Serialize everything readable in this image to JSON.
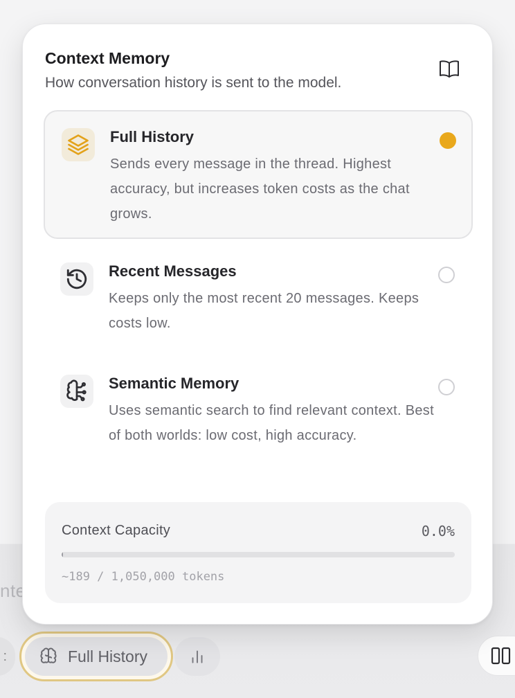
{
  "background": {
    "partial_text": "nte"
  },
  "popover": {
    "title": "Context Memory",
    "subtitle": "How conversation history is sent to the model.",
    "options": [
      {
        "label": "Full History",
        "description": "Sends every message in the thread. Highest accuracy, but increases token costs as the chat grows.",
        "icon": "layers-icon",
        "selected": true
      },
      {
        "label": "Recent Messages",
        "description": "Keeps only the most recent 20 messages. Keeps costs low.",
        "icon": "history-icon",
        "selected": false
      },
      {
        "label": "Semantic Memory",
        "description": "Uses semantic search to find relevant context. Best of both worlds: low cost, high accuracy.",
        "icon": "brain-circuit-icon",
        "selected": false
      }
    ],
    "capacity": {
      "label": "Context Capacity",
      "percent_text": "0.0%",
      "fill_fraction": 0.0002,
      "tokens_used": "~189",
      "tokens_total": "1,050,000",
      "tokens_text": "~189 / 1,050,000 tokens"
    }
  },
  "toolbar": {
    "context_button_label": "Full History",
    "context_button_icon": "brain-icon",
    "stats_icon": "bar-chart-icon",
    "columns_icon": "columns-icon"
  },
  "colors": {
    "accent": "#e9a81c",
    "accent_border": "#e0c783"
  }
}
